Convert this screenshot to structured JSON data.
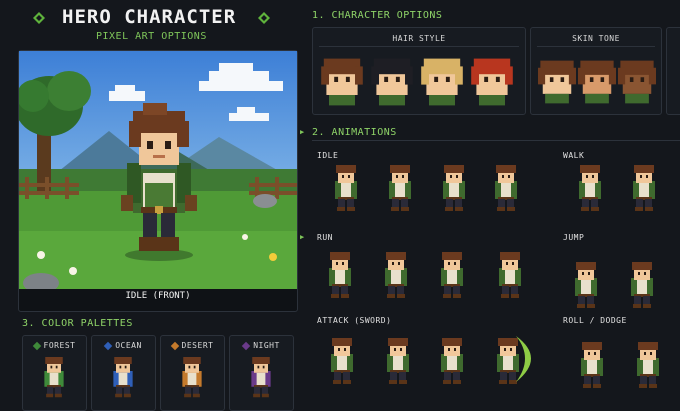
{
  "header": {
    "title": "HERO CHARACTER",
    "subtitle": "PIXEL ART OPTIONS"
  },
  "preview": {
    "caption": "IDLE (FRONT)"
  },
  "character_options": {
    "heading": "1. CHARACTER OPTIONS",
    "hair_style_label": "HAIR STYLE",
    "skin_tone_label": "SKIN TONE",
    "hair_colors": [
      "#6b3a1f",
      "#1e1e24",
      "#d8b266",
      "#b8361f"
    ],
    "skin_tones": [
      "#f0c79a",
      "#d89a6a",
      "#8a5532"
    ]
  },
  "animations": {
    "heading": "2. ANIMATIONS",
    "groups": [
      {
        "label": "IDLE"
      },
      {
        "label": "WALK"
      },
      {
        "label": "RUN"
      },
      {
        "label": "JUMP"
      },
      {
        "label": "ATTACK (SWORD)"
      },
      {
        "label": "ROLL / DODGE"
      }
    ]
  },
  "color_palettes": {
    "heading": "3. COLOR PALETTES",
    "palettes": [
      {
        "label": "FOREST",
        "color": "#3f8a3a"
      },
      {
        "label": "OCEAN",
        "color": "#2f5fb8"
      },
      {
        "label": "DESERT",
        "color": "#c47a2c"
      },
      {
        "label": "NIGHT",
        "color": "#6a3a8a"
      }
    ]
  }
}
